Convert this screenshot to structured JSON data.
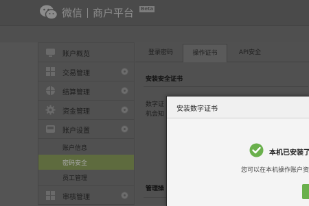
{
  "header": {
    "brand_a": "微信",
    "brand_b": "商户平台",
    "beta": "Beta"
  },
  "sidebar": {
    "items": [
      {
        "label": "账户概览",
        "icon": "monitor-icon"
      },
      {
        "label": "交易管理",
        "icon": "grid-icon"
      },
      {
        "label": "结算管理",
        "icon": "globe-icon"
      },
      {
        "label": "资金管理",
        "icon": "gear-icon"
      },
      {
        "label": "账户设置",
        "icon": "inbox-icon"
      },
      {
        "label": "审核管理",
        "icon": "grid-icon"
      }
    ],
    "subitems": [
      {
        "label": "账户信息"
      },
      {
        "label": "密码安全",
        "active": true
      },
      {
        "label": "员工管理"
      }
    ]
  },
  "tabs": [
    {
      "label": "登录密码"
    },
    {
      "label": "操作证书",
      "active": true
    },
    {
      "label": "API安全"
    }
  ],
  "content": {
    "section_title": "安装安全证书",
    "para_line1": "数字证",
    "para_line2": "机会知",
    "section2_title": "管理操"
  },
  "dialog": {
    "title": "安装数字证书",
    "message": "本机已安装了",
    "sub": "您可以在本机操作账户资"
  },
  "colors": {
    "accent": "#5e6b3e",
    "success": "#6ab04c"
  }
}
